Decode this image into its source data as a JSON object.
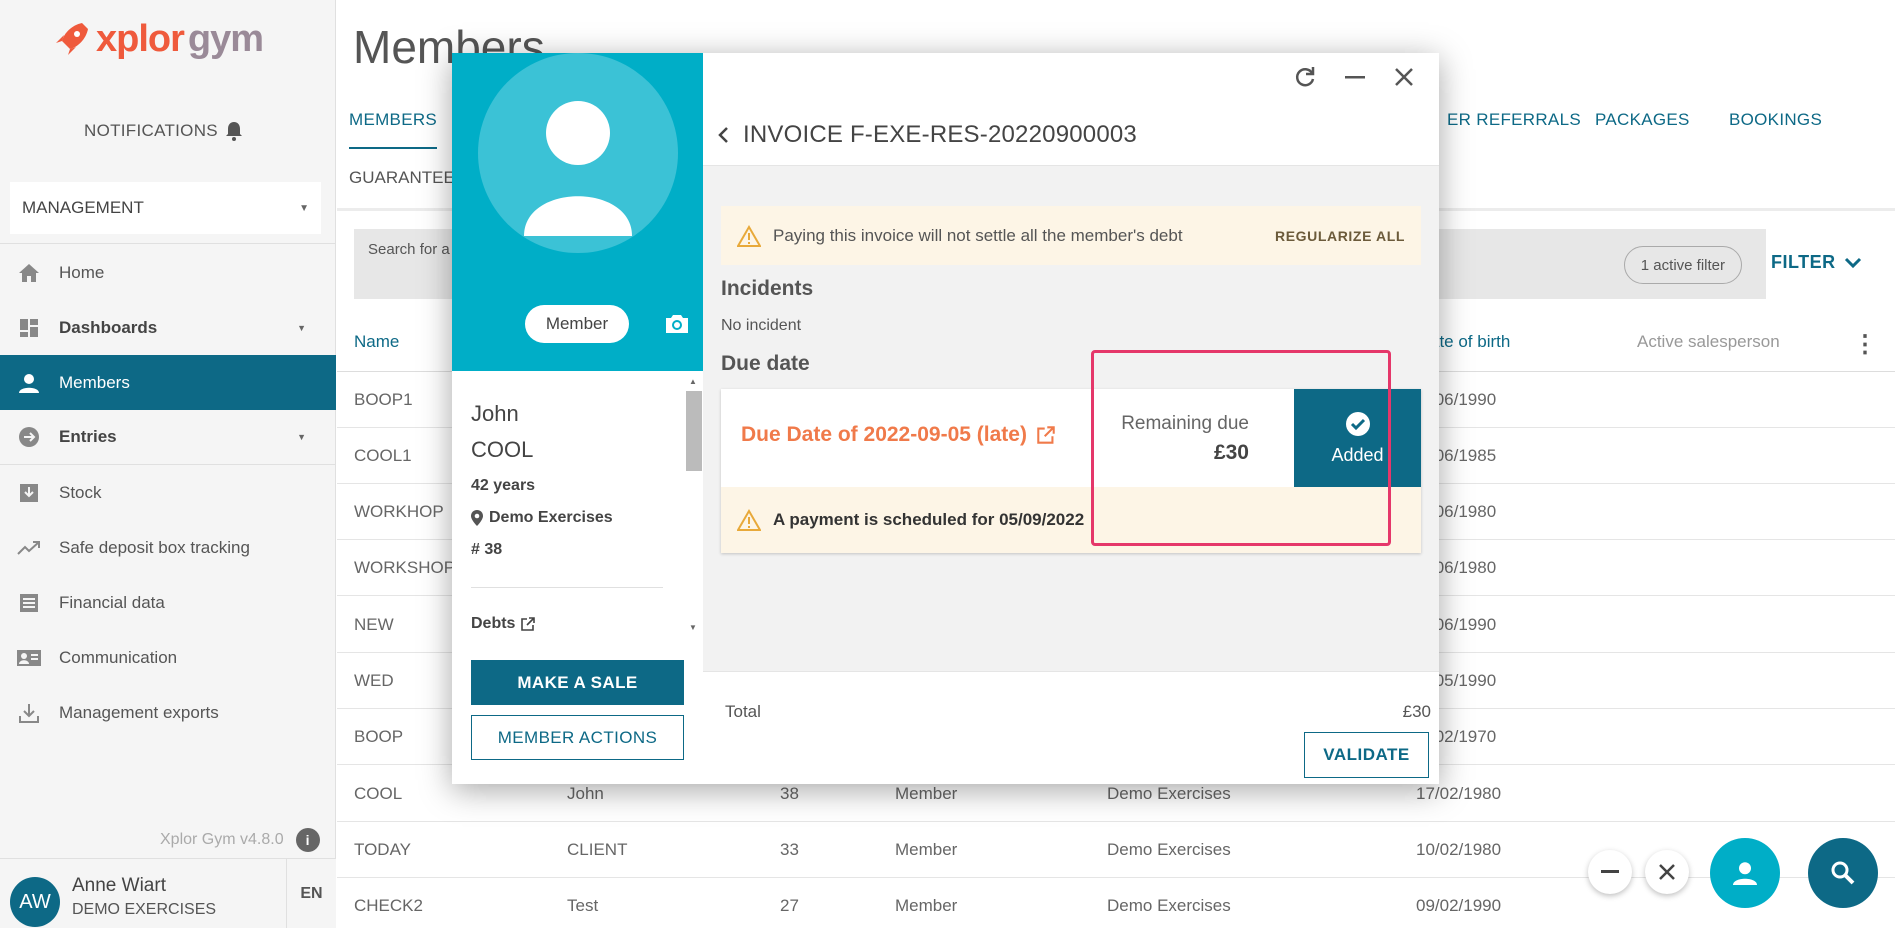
{
  "brand": {
    "logo_x": "xplor",
    "logo_gym": "gym"
  },
  "sidebar": {
    "notifications": "NOTIFICATIONS",
    "management": "MANAGEMENT",
    "items": [
      {
        "label": "Home",
        "icon": "home-icon"
      },
      {
        "label": "Dashboards",
        "icon": "dashboard-icon",
        "dropdown": true
      },
      {
        "label": "Members",
        "icon": "person-icon",
        "active": true
      },
      {
        "label": "Entries",
        "icon": "entries-icon",
        "dropdown": true
      },
      {
        "label": "Stock",
        "icon": "stock-icon"
      },
      {
        "label": "Safe deposit box tracking",
        "icon": "trend-icon"
      },
      {
        "label": "Financial data",
        "icon": "list-icon"
      },
      {
        "label": "Communication",
        "icon": "contact-card-icon"
      },
      {
        "label": "Management exports",
        "icon": "download-icon"
      }
    ],
    "version": "Xplor Gym v4.8.0",
    "user": {
      "initials": "AW",
      "name": "Anne Wiart",
      "club": "DEMO EXERCISES",
      "lang": "EN"
    }
  },
  "main": {
    "title": "Members",
    "tabs": {
      "members": "MEMBERS",
      "referrals": "ER REFERRALS",
      "packages": "PACKAGES",
      "bookings": "BOOKINGS",
      "guarantee": "GUARANTEE"
    },
    "search_placeholder": "Search for a",
    "active_filter": "1 active filter",
    "filter": "FILTER",
    "headers": {
      "name": "Name",
      "dob": "ate of birth",
      "salesperson": "Active salesperson"
    },
    "rows": [
      {
        "name": "BOOP1",
        "first": "",
        "num": "",
        "type": "",
        "club": "",
        "dob": "/06/1990"
      },
      {
        "name": "COOL1",
        "first": "",
        "num": "",
        "type": "",
        "club": "",
        "dob": "/06/1985"
      },
      {
        "name": "WORKHOP",
        "first": "",
        "num": "",
        "type": "",
        "club": "",
        "dob": "/06/1980"
      },
      {
        "name": "WORKSHOP",
        "first": "",
        "num": "",
        "type": "",
        "club": "",
        "dob": "/06/1980"
      },
      {
        "name": "NEW",
        "first": "",
        "num": "",
        "type": "",
        "club": "",
        "dob": "/06/1990"
      },
      {
        "name": "WED",
        "first": "",
        "num": "",
        "type": "",
        "club": "",
        "dob": "/05/1990"
      },
      {
        "name": "BOOP",
        "first": "",
        "num": "",
        "type": "",
        "club": "",
        "dob": "/02/1970"
      },
      {
        "name": "COOL",
        "first": "John",
        "num": "38",
        "type": "Member",
        "club": "Demo Exercises",
        "dob": "17/02/1980"
      },
      {
        "name": "TODAY",
        "first": "CLIENT",
        "num": "33",
        "type": "Member",
        "club": "Demo Exercises",
        "dob": "10/02/1980"
      },
      {
        "name": "CHECK2",
        "first": "Test",
        "num": "27",
        "type": "Member",
        "club": "Demo Exercises",
        "dob": "09/02/1990"
      }
    ]
  },
  "modal": {
    "member_badge": "Member",
    "first_name": "John",
    "last_name": "COOL",
    "age": "42 years",
    "club": "Demo Exercises",
    "number": "# 38",
    "debts": "Debts",
    "make_sale": "MAKE A SALE",
    "member_actions": "MEMBER ACTIONS",
    "invoice_title": "INVOICE F-EXE-RES-20220900003",
    "warning": "Paying this invoice will not settle all the member's debt",
    "regularize": "REGULARIZE ALL",
    "incidents_title": "Incidents",
    "no_incident": "No incident",
    "due_title": "Due date",
    "due_date": "Due Date of 2022-09-05 (late)",
    "remaining_label": "Remaining due",
    "remaining_value": "£30",
    "added": "Added",
    "scheduled": "A payment is scheduled for 05/09/2022",
    "total_label": "Total",
    "total_value": "£30",
    "validate": "VALIDATE"
  },
  "colors": {
    "primary": "#0d6986",
    "cyan": "#00aec7",
    "orange": "#f07a4a",
    "highlight": "#e5376a",
    "warn_bg": "#fdf5e6"
  }
}
